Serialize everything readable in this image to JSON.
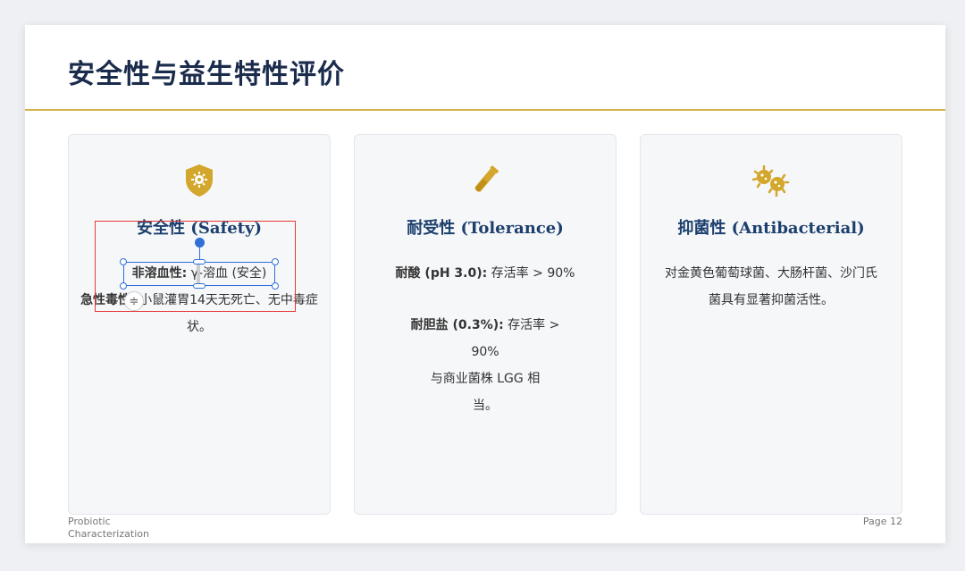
{
  "slide": {
    "title": "安全性与益生特性评价",
    "footer_left_line1": "Probiotic",
    "footer_left_line2": "Characterization",
    "footer_right": "Page 12"
  },
  "colors": {
    "title": "#1a2b4c",
    "accent_gold": "#d3b24b",
    "card_title": "#1c3f6e",
    "selection_red": "#e53935",
    "selection_blue": "#2f6fd6"
  },
  "cards": [
    {
      "icon": "shield-virus-icon",
      "title": "安全性 (Safety)",
      "p1_label": "非溶血性:",
      "p1_text": " γ-溶血 (安全)",
      "p2_label": "急性毒性:",
      "p2_text": " 小鼠灌胃14天无死亡、无中毒症状。"
    },
    {
      "icon": "test-tube-icon",
      "title": "耐受性 (Tolerance)",
      "p1_label": "耐酸 (pH 3.0):",
      "p1_text": " 存活率 > 90%",
      "p2_label": "耐胆盐 (0.3%):",
      "p2_text": " 存活率 > 90%",
      "p3_text": "与商业菌株 LGG 相当。"
    },
    {
      "icon": "bacteria-icon",
      "title": "抑菌性 (Antibacterial)",
      "p1_text": "对金黄色葡萄球菌、大肠杆菌、沙门氏菌具有显著抑菌活性。"
    }
  ],
  "editor": {
    "spacing_icon": "line-spacing-icon",
    "spacing_glyph": "≑"
  }
}
